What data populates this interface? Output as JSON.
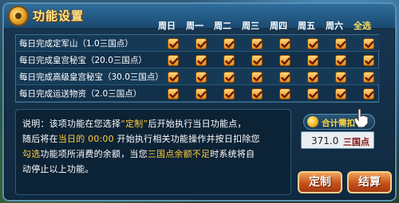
{
  "dialog": {
    "title": "功能设置",
    "days": [
      "周日",
      "周一",
      "周二",
      "周三",
      "周四",
      "周五",
      "周六",
      "全选"
    ]
  },
  "tasks": [
    {
      "label": "每日完成定军山（1.0三国点）",
      "checked": [
        true,
        true,
        true,
        true,
        true,
        true,
        true,
        true
      ]
    },
    {
      "label": "每日完成皇宫秘宝（20.0三国点）",
      "checked": [
        true,
        true,
        true,
        true,
        true,
        true,
        true,
        true
      ]
    },
    {
      "label": "每日完成高级皇宫秘宝（30.0三国点）",
      "checked": [
        true,
        true,
        true,
        true,
        true,
        true,
        true,
        true
      ]
    },
    {
      "label": "每日完成运送物资（2.0三国点）",
      "checked": [
        true,
        true,
        true,
        true,
        true,
        true,
        true,
        true
      ]
    }
  ],
  "info": {
    "line1_a": "说明：该项功能在您选择",
    "line1_b": "“定制”",
    "line1_c": "后开始执行当日功能点，",
    "line2_a": "随后将在",
    "line2_b": "当日的",
    "line2_c": "00:00",
    "line2_d": "开始执行相关功能操作并按日扣除您",
    "line3_a": "勾选",
    "line3_b": "功能项所消费的余额，当您",
    "line3_c": "三国点余额不足",
    "line3_d": "时系统将自",
    "line4": "动停止以上功能。"
  },
  "cost": {
    "label": "合计需扣",
    "value": "371.0",
    "unit": "三国点"
  },
  "buttons": {
    "custom": "定制",
    "settle": "结算"
  },
  "background": {
    "strip_left": "…",
    "strip_right": "…"
  },
  "colors": {
    "accent": "#ffce3a",
    "warning": "#ff5a3a",
    "button": "#c8501a"
  }
}
